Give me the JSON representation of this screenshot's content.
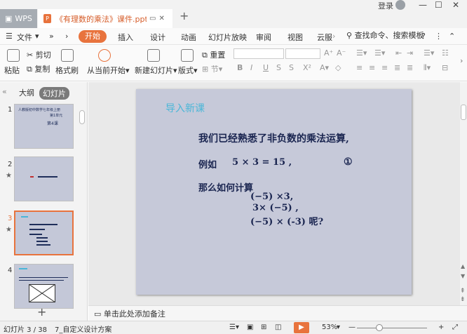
{
  "titlebar": {
    "wps_tab": "WPS",
    "doc_tab": "《有理数的乘法》课件.ppt",
    "login": "登录"
  },
  "menu": {
    "file": "文件",
    "items": [
      "开始",
      "插入",
      "设计",
      "动画",
      "幻灯片放映",
      "审阅",
      "视图",
      "云服"
    ],
    "search": "查找命令、搜索模板"
  },
  "ribbon": {
    "paste": "粘贴",
    "cut": "剪切",
    "copy": "复制",
    "format_painter": "格式刷",
    "from_current": "从当前开始",
    "new_slide": "新建幻灯片",
    "layout": "版式",
    "reset": "重置",
    "section": "节"
  },
  "leftpane": {
    "tab_outline": "大纲",
    "tab_slides": "幻灯片",
    "slide_numbers": [
      "1",
      "2",
      "3",
      "4"
    ],
    "thumb1": {
      "line1": "人教版初中数学七年级上册",
      "line2": "第1单元",
      "line3": "第4课"
    }
  },
  "slide": {
    "title": "导入新课",
    "line1": "我们已经熟悉了非负数的乘法运算,",
    "example": "例如",
    "equation": "5 × 3 = 15 ,",
    "circle_num": "①",
    "question": "那么如何计算",
    "expr1": "(−5) ×3,",
    "expr2": "3× (−5) ,",
    "expr3": "(−5) × (-3) 呢?"
  },
  "notes": {
    "placeholder": "单击此处添加备注"
  },
  "status": {
    "slide_count": "幻灯片 3 / 38",
    "template": "7_自定义设计方案",
    "zoom": "53%"
  },
  "colors": {
    "accent": "#e8733d",
    "slide_bg": "#c6c9d9",
    "slide_title": "#49b6d8",
    "slide_text": "#1a2550"
  }
}
